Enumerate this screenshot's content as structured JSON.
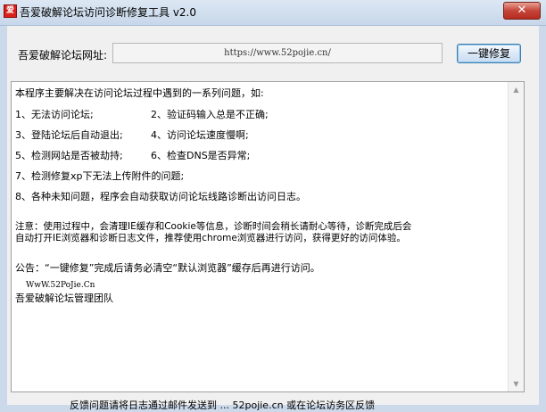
{
  "window": {
    "icon_glyph": "爱",
    "title": "吾爱破解论坛访问诊断修复工具 v2.0",
    "close_label": "✕"
  },
  "form": {
    "url_label": "吾爱破解论坛网址:",
    "url_value": "https://www.52pojie.cn/",
    "repair_button": "一键修复"
  },
  "info": {
    "intro": "本程序主要解决在访问论坛过程中遇到的一系列问题，如:",
    "items": [
      "1、无法访问论坛;",
      "2、验证码输入总是不正确;",
      "3、登陆论坛后自动退出;",
      "4、访问论坛速度慢啊;",
      "5、检测网站是否被劫持;",
      "6、检查DNS是否异常;",
      "7、检测修复xp下无法上传附件的问题;",
      "8、各种未知问题，程序会自动获取访问论坛线路诊断出访问日志。"
    ],
    "note_line1": "注意：使用过程中，会清理IE缓存和Cookie等信息，诊断时间会稍长请耐心等待，诊断完成后会",
    "note_line2": "自动打开IE浏览器和诊断日志文件，推荐使用chrome浏览器进行访问，获得更好的访问体验。",
    "notice": "公告：“一键修复”完成后请务必清空“默认浏览器”缓存后再进行访问。",
    "site_name": "WwW.52PoJie.Cn",
    "team": "吾爱破解论坛管理团队"
  },
  "scrollbar": {
    "up_arrow": "▲",
    "down_arrow": "▼"
  },
  "footer": {
    "text": "反馈问题请将日志通过邮件发送到 ... 52pojie.cn 或在论坛访务区反馈"
  }
}
